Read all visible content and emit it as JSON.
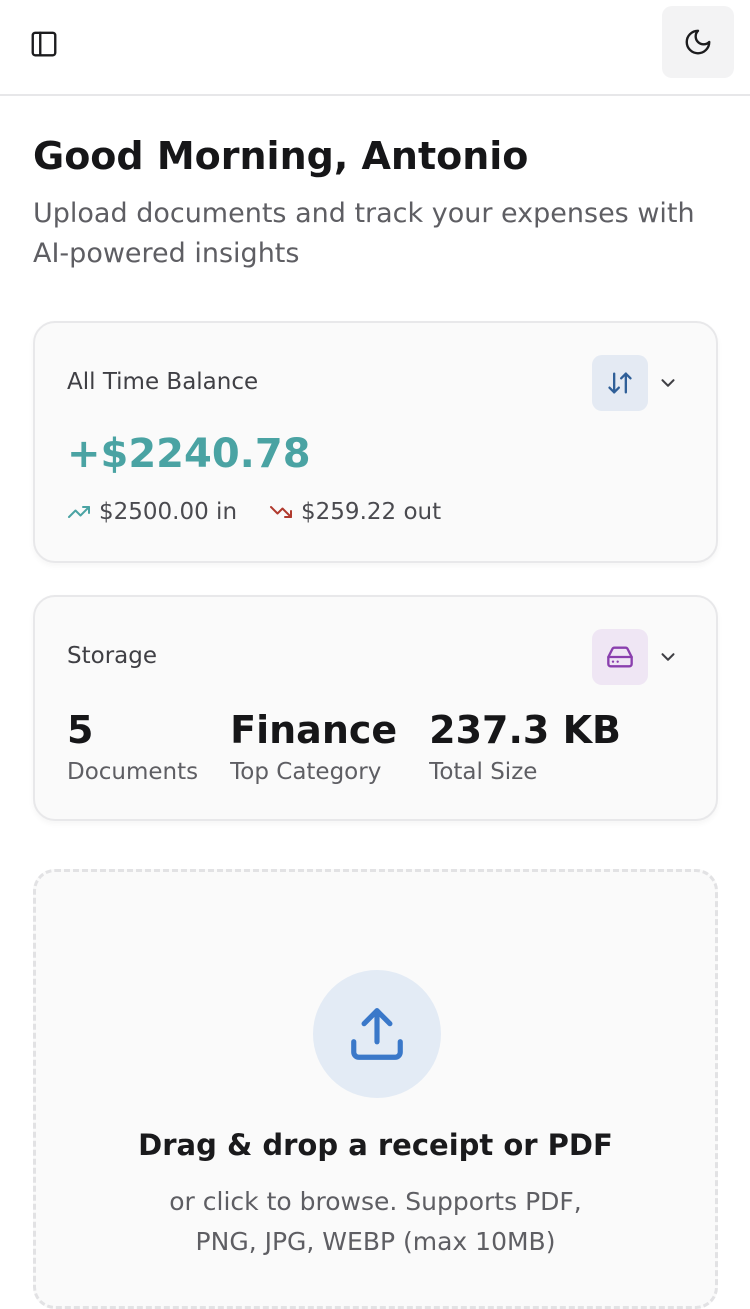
{
  "header": {
    "sidebar_toggle_icon": "panel-left-icon",
    "theme_toggle_icon": "moon-icon"
  },
  "welcome": {
    "greeting": "Good Morning, Antonio",
    "subtitle": "Upload documents and track your expenses with AI-powered insights"
  },
  "balance_card": {
    "title": "All Time Balance",
    "icon": "arrow-up-down-icon",
    "amount": "+$2240.78",
    "income": "$2500.00 in",
    "expense": "$259.22 out",
    "colors": {
      "amount": "#4aa3a3",
      "income_icon": "#4aa3a3",
      "expense_icon": "#b03a2e"
    }
  },
  "storage_card": {
    "title": "Storage",
    "icon": "hard-drive-icon",
    "stats": [
      {
        "value": "5",
        "label": "Documents"
      },
      {
        "value": "Finance",
        "label": "Top Category"
      },
      {
        "value": "237.3 KB",
        "label": "Total Size"
      }
    ]
  },
  "upload": {
    "icon": "upload-icon",
    "title": "Drag & drop a receipt or PDF",
    "hint": "or click to browse. Supports PDF, PNG, JPG, WEBP (max 10MB)",
    "accent": "#3a78c9"
  }
}
